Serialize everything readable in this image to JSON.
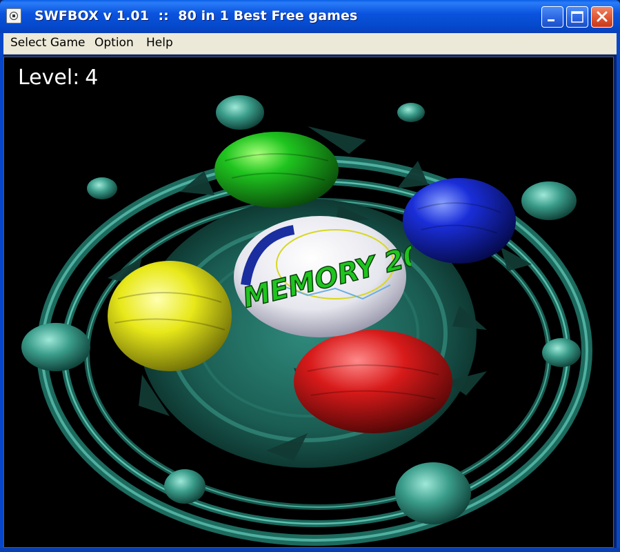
{
  "window": {
    "title": "SWFBOX v 1.01  ::  80 in 1 Best Free games",
    "icon": "app-icon",
    "controls": [
      "minimize-icon",
      "maximize-icon",
      "close-icon"
    ]
  },
  "menu": {
    "items": [
      {
        "label": "Select Game"
      },
      {
        "label": "Option"
      },
      {
        "label": "Help"
      }
    ]
  },
  "game": {
    "level_label": "Level:",
    "level_value": "4",
    "logo_text": "MEMORY 2000",
    "eggs": [
      {
        "color_name": "green",
        "color": "#1fb41f"
      },
      {
        "color_name": "blue",
        "color": "#1a2ed8"
      },
      {
        "color_name": "yellow",
        "color": "#e8e81a"
      },
      {
        "color_name": "red",
        "color": "#d81a1a"
      }
    ],
    "ring_color": "#2e8c7c",
    "background": "#000000"
  }
}
